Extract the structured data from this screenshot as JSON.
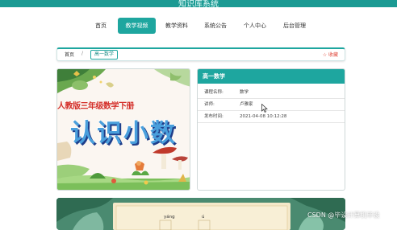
{
  "site_title": "知识库系统",
  "nav": {
    "items": [
      "首页",
      "教学视频",
      "教学资料",
      "系统公告",
      "个人中心",
      "后台管理"
    ],
    "active_index": 1
  },
  "breadcrumb": {
    "home": "首页",
    "separator": "/",
    "current": "高一数学"
  },
  "favorite_label": "☆ 收藏",
  "cover": {
    "subtitle": "人教版三年级数学下册",
    "title": "认识小数"
  },
  "detail": {
    "title": "高一数学",
    "rows": [
      {
        "label": "课程名称:",
        "value": "数学"
      },
      {
        "label": "讲师:",
        "value": "卢雅家"
      },
      {
        "label": "发布时间:",
        "value": "2021-04-08 10:12:28"
      }
    ]
  },
  "bottom_banner": {
    "pinyin": [
      "yáng",
      "ú"
    ]
  },
  "watermark": "CSDN @毕设计算机毕设",
  "colors": {
    "brand": "#1ea69f",
    "favorite": "#e0473a"
  }
}
